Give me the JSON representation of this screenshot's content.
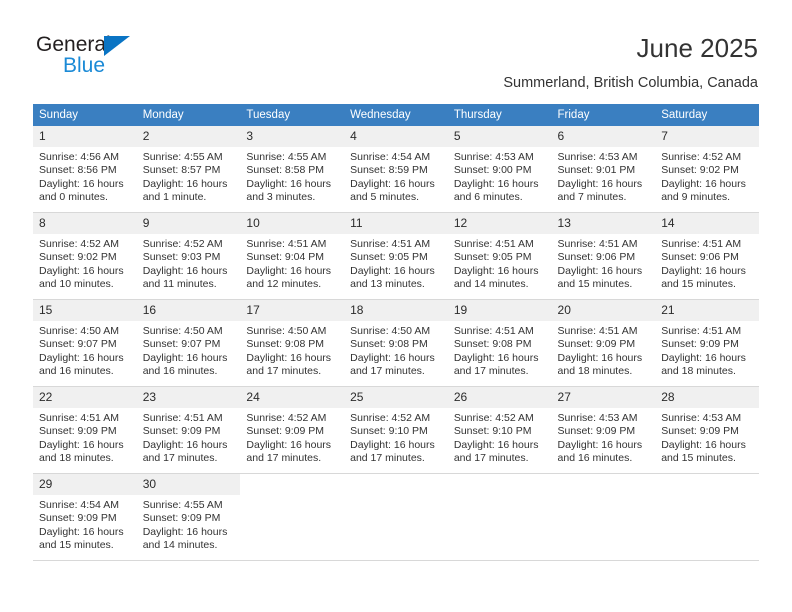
{
  "brand": {
    "name_dark": "General",
    "name_blue": "Blue",
    "accent_blue": "#1b8ad6",
    "triangle_blue": "#0a74c4"
  },
  "header": {
    "title": "June 2025",
    "subtitle": "Summerland, British Columbia, Canada",
    "header_bg": "#3a7fc1",
    "daynum_bg": "#f0f0f0"
  },
  "calendar": {
    "weekdays": [
      "Sunday",
      "Monday",
      "Tuesday",
      "Wednesday",
      "Thursday",
      "Friday",
      "Saturday"
    ],
    "labels": {
      "sunrise": "Sunrise:",
      "sunset": "Sunset:",
      "daylight": "Daylight:"
    },
    "weeks": [
      [
        {
          "day": "1",
          "sunrise": "Sunrise: 4:56 AM",
          "sunset": "Sunset: 8:56 PM",
          "daylight_line1": "Daylight: 16 hours",
          "daylight_line2": "and 0 minutes."
        },
        {
          "day": "2",
          "sunrise": "Sunrise: 4:55 AM",
          "sunset": "Sunset: 8:57 PM",
          "daylight_line1": "Daylight: 16 hours",
          "daylight_line2": "and 1 minute."
        },
        {
          "day": "3",
          "sunrise": "Sunrise: 4:55 AM",
          "sunset": "Sunset: 8:58 PM",
          "daylight_line1": "Daylight: 16 hours",
          "daylight_line2": "and 3 minutes."
        },
        {
          "day": "4",
          "sunrise": "Sunrise: 4:54 AM",
          "sunset": "Sunset: 8:59 PM",
          "daylight_line1": "Daylight: 16 hours",
          "daylight_line2": "and 5 minutes."
        },
        {
          "day": "5",
          "sunrise": "Sunrise: 4:53 AM",
          "sunset": "Sunset: 9:00 PM",
          "daylight_line1": "Daylight: 16 hours",
          "daylight_line2": "and 6 minutes."
        },
        {
          "day": "6",
          "sunrise": "Sunrise: 4:53 AM",
          "sunset": "Sunset: 9:01 PM",
          "daylight_line1": "Daylight: 16 hours",
          "daylight_line2": "and 7 minutes."
        },
        {
          "day": "7",
          "sunrise": "Sunrise: 4:52 AM",
          "sunset": "Sunset: 9:02 PM",
          "daylight_line1": "Daylight: 16 hours",
          "daylight_line2": "and 9 minutes."
        }
      ],
      [
        {
          "day": "8",
          "sunrise": "Sunrise: 4:52 AM",
          "sunset": "Sunset: 9:02 PM",
          "daylight_line1": "Daylight: 16 hours",
          "daylight_line2": "and 10 minutes."
        },
        {
          "day": "9",
          "sunrise": "Sunrise: 4:52 AM",
          "sunset": "Sunset: 9:03 PM",
          "daylight_line1": "Daylight: 16 hours",
          "daylight_line2": "and 11 minutes."
        },
        {
          "day": "10",
          "sunrise": "Sunrise: 4:51 AM",
          "sunset": "Sunset: 9:04 PM",
          "daylight_line1": "Daylight: 16 hours",
          "daylight_line2": "and 12 minutes."
        },
        {
          "day": "11",
          "sunrise": "Sunrise: 4:51 AM",
          "sunset": "Sunset: 9:05 PM",
          "daylight_line1": "Daylight: 16 hours",
          "daylight_line2": "and 13 minutes."
        },
        {
          "day": "12",
          "sunrise": "Sunrise: 4:51 AM",
          "sunset": "Sunset: 9:05 PM",
          "daylight_line1": "Daylight: 16 hours",
          "daylight_line2": "and 14 minutes."
        },
        {
          "day": "13",
          "sunrise": "Sunrise: 4:51 AM",
          "sunset": "Sunset: 9:06 PM",
          "daylight_line1": "Daylight: 16 hours",
          "daylight_line2": "and 15 minutes."
        },
        {
          "day": "14",
          "sunrise": "Sunrise: 4:51 AM",
          "sunset": "Sunset: 9:06 PM",
          "daylight_line1": "Daylight: 16 hours",
          "daylight_line2": "and 15 minutes."
        }
      ],
      [
        {
          "day": "15",
          "sunrise": "Sunrise: 4:50 AM",
          "sunset": "Sunset: 9:07 PM",
          "daylight_line1": "Daylight: 16 hours",
          "daylight_line2": "and 16 minutes."
        },
        {
          "day": "16",
          "sunrise": "Sunrise: 4:50 AM",
          "sunset": "Sunset: 9:07 PM",
          "daylight_line1": "Daylight: 16 hours",
          "daylight_line2": "and 16 minutes."
        },
        {
          "day": "17",
          "sunrise": "Sunrise: 4:50 AM",
          "sunset": "Sunset: 9:08 PM",
          "daylight_line1": "Daylight: 16 hours",
          "daylight_line2": "and 17 minutes."
        },
        {
          "day": "18",
          "sunrise": "Sunrise: 4:50 AM",
          "sunset": "Sunset: 9:08 PM",
          "daylight_line1": "Daylight: 16 hours",
          "daylight_line2": "and 17 minutes."
        },
        {
          "day": "19",
          "sunrise": "Sunrise: 4:51 AM",
          "sunset": "Sunset: 9:08 PM",
          "daylight_line1": "Daylight: 16 hours",
          "daylight_line2": "and 17 minutes."
        },
        {
          "day": "20",
          "sunrise": "Sunrise: 4:51 AM",
          "sunset": "Sunset: 9:09 PM",
          "daylight_line1": "Daylight: 16 hours",
          "daylight_line2": "and 18 minutes."
        },
        {
          "day": "21",
          "sunrise": "Sunrise: 4:51 AM",
          "sunset": "Sunset: 9:09 PM",
          "daylight_line1": "Daylight: 16 hours",
          "daylight_line2": "and 18 minutes."
        }
      ],
      [
        {
          "day": "22",
          "sunrise": "Sunrise: 4:51 AM",
          "sunset": "Sunset: 9:09 PM",
          "daylight_line1": "Daylight: 16 hours",
          "daylight_line2": "and 18 minutes."
        },
        {
          "day": "23",
          "sunrise": "Sunrise: 4:51 AM",
          "sunset": "Sunset: 9:09 PM",
          "daylight_line1": "Daylight: 16 hours",
          "daylight_line2": "and 17 minutes."
        },
        {
          "day": "24",
          "sunrise": "Sunrise: 4:52 AM",
          "sunset": "Sunset: 9:09 PM",
          "daylight_line1": "Daylight: 16 hours",
          "daylight_line2": "and 17 minutes."
        },
        {
          "day": "25",
          "sunrise": "Sunrise: 4:52 AM",
          "sunset": "Sunset: 9:10 PM",
          "daylight_line1": "Daylight: 16 hours",
          "daylight_line2": "and 17 minutes."
        },
        {
          "day": "26",
          "sunrise": "Sunrise: 4:52 AM",
          "sunset": "Sunset: 9:10 PM",
          "daylight_line1": "Daylight: 16 hours",
          "daylight_line2": "and 17 minutes."
        },
        {
          "day": "27",
          "sunrise": "Sunrise: 4:53 AM",
          "sunset": "Sunset: 9:09 PM",
          "daylight_line1": "Daylight: 16 hours",
          "daylight_line2": "and 16 minutes."
        },
        {
          "day": "28",
          "sunrise": "Sunrise: 4:53 AM",
          "sunset": "Sunset: 9:09 PM",
          "daylight_line1": "Daylight: 16 hours",
          "daylight_line2": "and 15 minutes."
        }
      ],
      [
        {
          "day": "29",
          "sunrise": "Sunrise: 4:54 AM",
          "sunset": "Sunset: 9:09 PM",
          "daylight_line1": "Daylight: 16 hours",
          "daylight_line2": "and 15 minutes."
        },
        {
          "day": "30",
          "sunrise": "Sunrise: 4:55 AM",
          "sunset": "Sunset: 9:09 PM",
          "daylight_line1": "Daylight: 16 hours",
          "daylight_line2": "and 14 minutes."
        },
        {
          "day": "",
          "sunrise": "",
          "sunset": "",
          "daylight_line1": "",
          "daylight_line2": ""
        },
        {
          "day": "",
          "sunrise": "",
          "sunset": "",
          "daylight_line1": "",
          "daylight_line2": ""
        },
        {
          "day": "",
          "sunrise": "",
          "sunset": "",
          "daylight_line1": "",
          "daylight_line2": ""
        },
        {
          "day": "",
          "sunrise": "",
          "sunset": "",
          "daylight_line1": "",
          "daylight_line2": ""
        },
        {
          "day": "",
          "sunrise": "",
          "sunset": "",
          "daylight_line1": "",
          "daylight_line2": ""
        }
      ]
    ]
  }
}
